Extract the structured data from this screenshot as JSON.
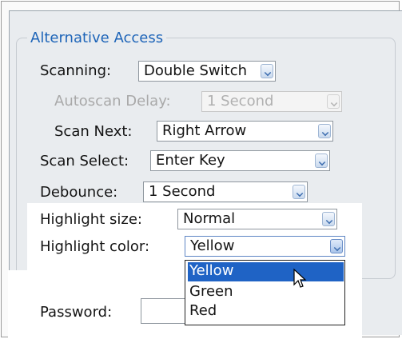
{
  "group": {
    "title": "Alternative Access"
  },
  "scanning": {
    "label": "Scanning:",
    "value": "Double Switch"
  },
  "autoscan_delay": {
    "label": "Autoscan Delay:",
    "value": "1 Second"
  },
  "scan_next": {
    "label": "Scan Next:",
    "value": "Right Arrow"
  },
  "scan_select": {
    "label": "Scan Select:",
    "value": "Enter Key"
  },
  "debounce": {
    "label": "Debounce:",
    "value": "1 Second"
  },
  "highlight_size": {
    "label": "Highlight size:",
    "value": "Normal"
  },
  "highlight_color": {
    "label": "Highlight color:",
    "value": "Yellow",
    "options": [
      "Yellow",
      "Green",
      "Red"
    ],
    "selected_index": 0
  },
  "password": {
    "label": "Password:",
    "value": ""
  },
  "colors": {
    "accent": "#1d64b8",
    "selection": "#1f63c5",
    "panel_bg": "#e9ecef"
  }
}
